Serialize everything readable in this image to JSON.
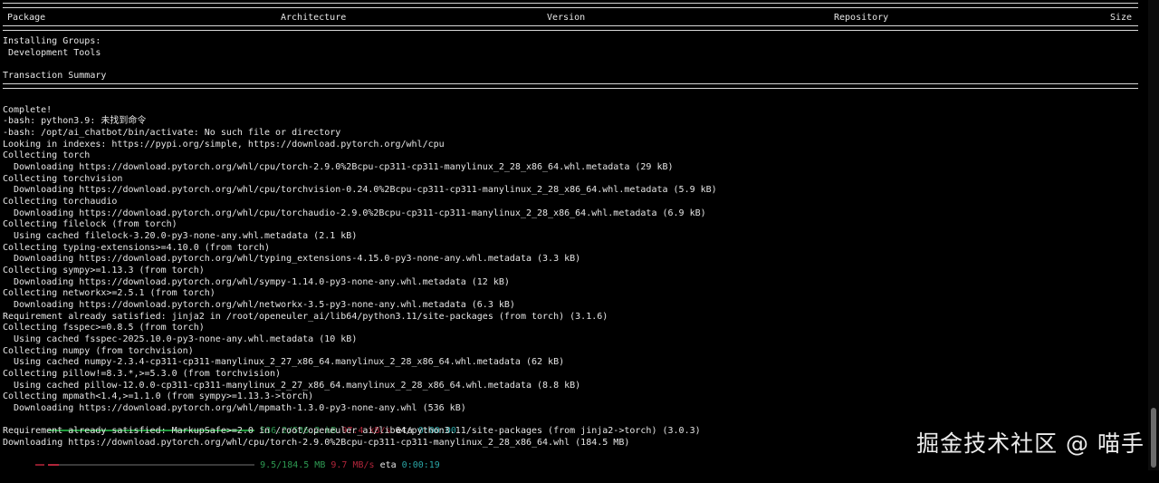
{
  "table_header": {
    "package": "Package",
    "architecture": "Architecture",
    "version": "Version",
    "repository": "Repository",
    "size": "Size"
  },
  "lines_top": [
    "Installing Groups:",
    " Development Tools",
    "",
    "Transaction Summary"
  ],
  "lines_main": [
    "",
    "Complete!",
    "-bash: python3.9: 未找到命令",
    "-bash: /opt/ai_chatbot/bin/activate: No such file or directory",
    "Looking in indexes: https://pypi.org/simple, https://download.pytorch.org/whl/cpu",
    "Collecting torch",
    "  Downloading https://download.pytorch.org/whl/cpu/torch-2.9.0%2Bcpu-cp311-cp311-manylinux_2_28_x86_64.whl.metadata (29 kB)",
    "Collecting torchvision",
    "  Downloading https://download.pytorch.org/whl/cpu/torchvision-0.24.0%2Bcpu-cp311-cp311-manylinux_2_28_x86_64.whl.metadata (5.9 kB)",
    "Collecting torchaudio",
    "  Downloading https://download.pytorch.org/whl/cpu/torchaudio-2.9.0%2Bcpu-cp311-cp311-manylinux_2_28_x86_64.whl.metadata (6.9 kB)",
    "Collecting filelock (from torch)",
    "  Using cached filelock-3.20.0-py3-none-any.whl.metadata (2.1 kB)",
    "Collecting typing-extensions>=4.10.0 (from torch)",
    "  Downloading https://download.pytorch.org/whl/typing_extensions-4.15.0-py3-none-any.whl.metadata (3.3 kB)",
    "Collecting sympy>=1.13.3 (from torch)",
    "  Downloading https://download.pytorch.org/whl/sympy-1.14.0-py3-none-any.whl.metadata (12 kB)",
    "Collecting networkx>=2.5.1 (from torch)",
    "  Downloading https://download.pytorch.org/whl/networkx-3.5-py3-none-any.whl.metadata (6.3 kB)",
    "Requirement already satisfied: jinja2 in /root/openeuler_ai/lib64/python3.11/site-packages (from torch) (3.1.6)",
    "Collecting fsspec>=0.8.5 (from torch)",
    "  Using cached fsspec-2025.10.0-py3-none-any.whl.metadata (10 kB)",
    "Collecting numpy (from torchvision)",
    "  Using cached numpy-2.3.4-cp311-cp311-manylinux_2_27_x86_64.manylinux_2_28_x86_64.whl.metadata (62 kB)",
    "Collecting pillow!=8.3.*,>=5.3.0 (from torchvision)",
    "  Using cached pillow-12.0.0-cp311-cp311-manylinux_2_27_x86_64.manylinux_2_28_x86_64.whl.metadata (8.8 kB)",
    "Collecting mpmath<1.4,>=1.1.0 (from sympy>=1.13.3->torch)",
    "  Downloading https://download.pytorch.org/whl/mpmath-1.3.0-py3-none-any.whl (536 kB)"
  ],
  "progress1": {
    "size": "536.2/536.2 kB",
    "speed": "97.4 kB/s",
    "eta_label": "eta",
    "eta": "0:00:00",
    "fraction": 1.0,
    "color_fill": "#1f9a3a",
    "color_size": "#2e9a52",
    "color_speed": "#b0253a",
    "color_eta": "#2aa6a6"
  },
  "lines_after1": [
    "Requirement already satisfied: MarkupSafe>=2.0 in /root/openeuler_ai/lib64/python3.11/site-packages (from jinja2->torch) (3.0.3)",
    "Downloading https://download.pytorch.org/whl/cpu/torch-2.9.0%2Bcpu-cp311-cp311-manylinux_2_28_x86_64.whl (184.5 MB)"
  ],
  "progress2": {
    "size": "9.5/184.5 MB",
    "speed": "9.7 MB/s",
    "eta_label": "eta",
    "eta": "0:00:19",
    "fraction": 0.051,
    "color_fill": "#b0253a",
    "color_size": "#2e9a52",
    "color_speed": "#b0253a",
    "color_eta": "#2aa6a6"
  },
  "watermark": "掘金技术社区 @ 喵手"
}
